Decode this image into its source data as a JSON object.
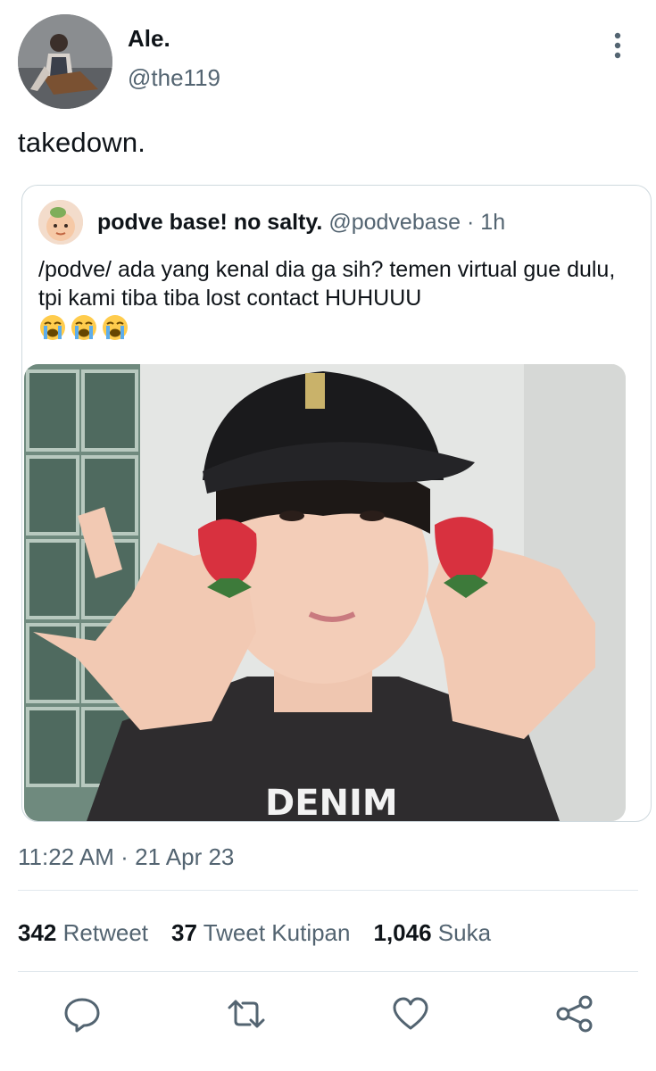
{
  "author": {
    "display_name": "Ale.",
    "handle": "@the119",
    "avatar_icon": "user-avatar"
  },
  "tweet": {
    "text": "takedown."
  },
  "quote": {
    "display_name": "podve base! no salty.",
    "handle": "@podvebase",
    "dot": "·",
    "time": "1h",
    "text": "/podve/ ada yang kenal dia ga sih? temen virtual gue dulu, tpi kami tiba tiba lost contact HUHUUU",
    "emojis": [
      "loudly-crying-face-emoji",
      "loudly-crying-face-emoji",
      "loudly-crying-face-emoji"
    ],
    "photo": "photo of a person in a black cap holding strawberries to cheeks"
  },
  "meta": {
    "time": "11:22 AM",
    "sep": "·",
    "date": "21 Apr 23"
  },
  "stats": [
    {
      "count": "342",
      "label": "Retweet"
    },
    {
      "count": "37",
      "label": "Tweet Kutipan"
    },
    {
      "count": "1,046",
      "label": "Suka"
    }
  ],
  "actions": [
    "reply-icon",
    "retweet-icon",
    "like-icon",
    "share-icon"
  ],
  "colors": {
    "text_primary": "#0f1419",
    "text_secondary": "#536471",
    "border": "#cfd9de",
    "divider": "#e1e8ed"
  }
}
